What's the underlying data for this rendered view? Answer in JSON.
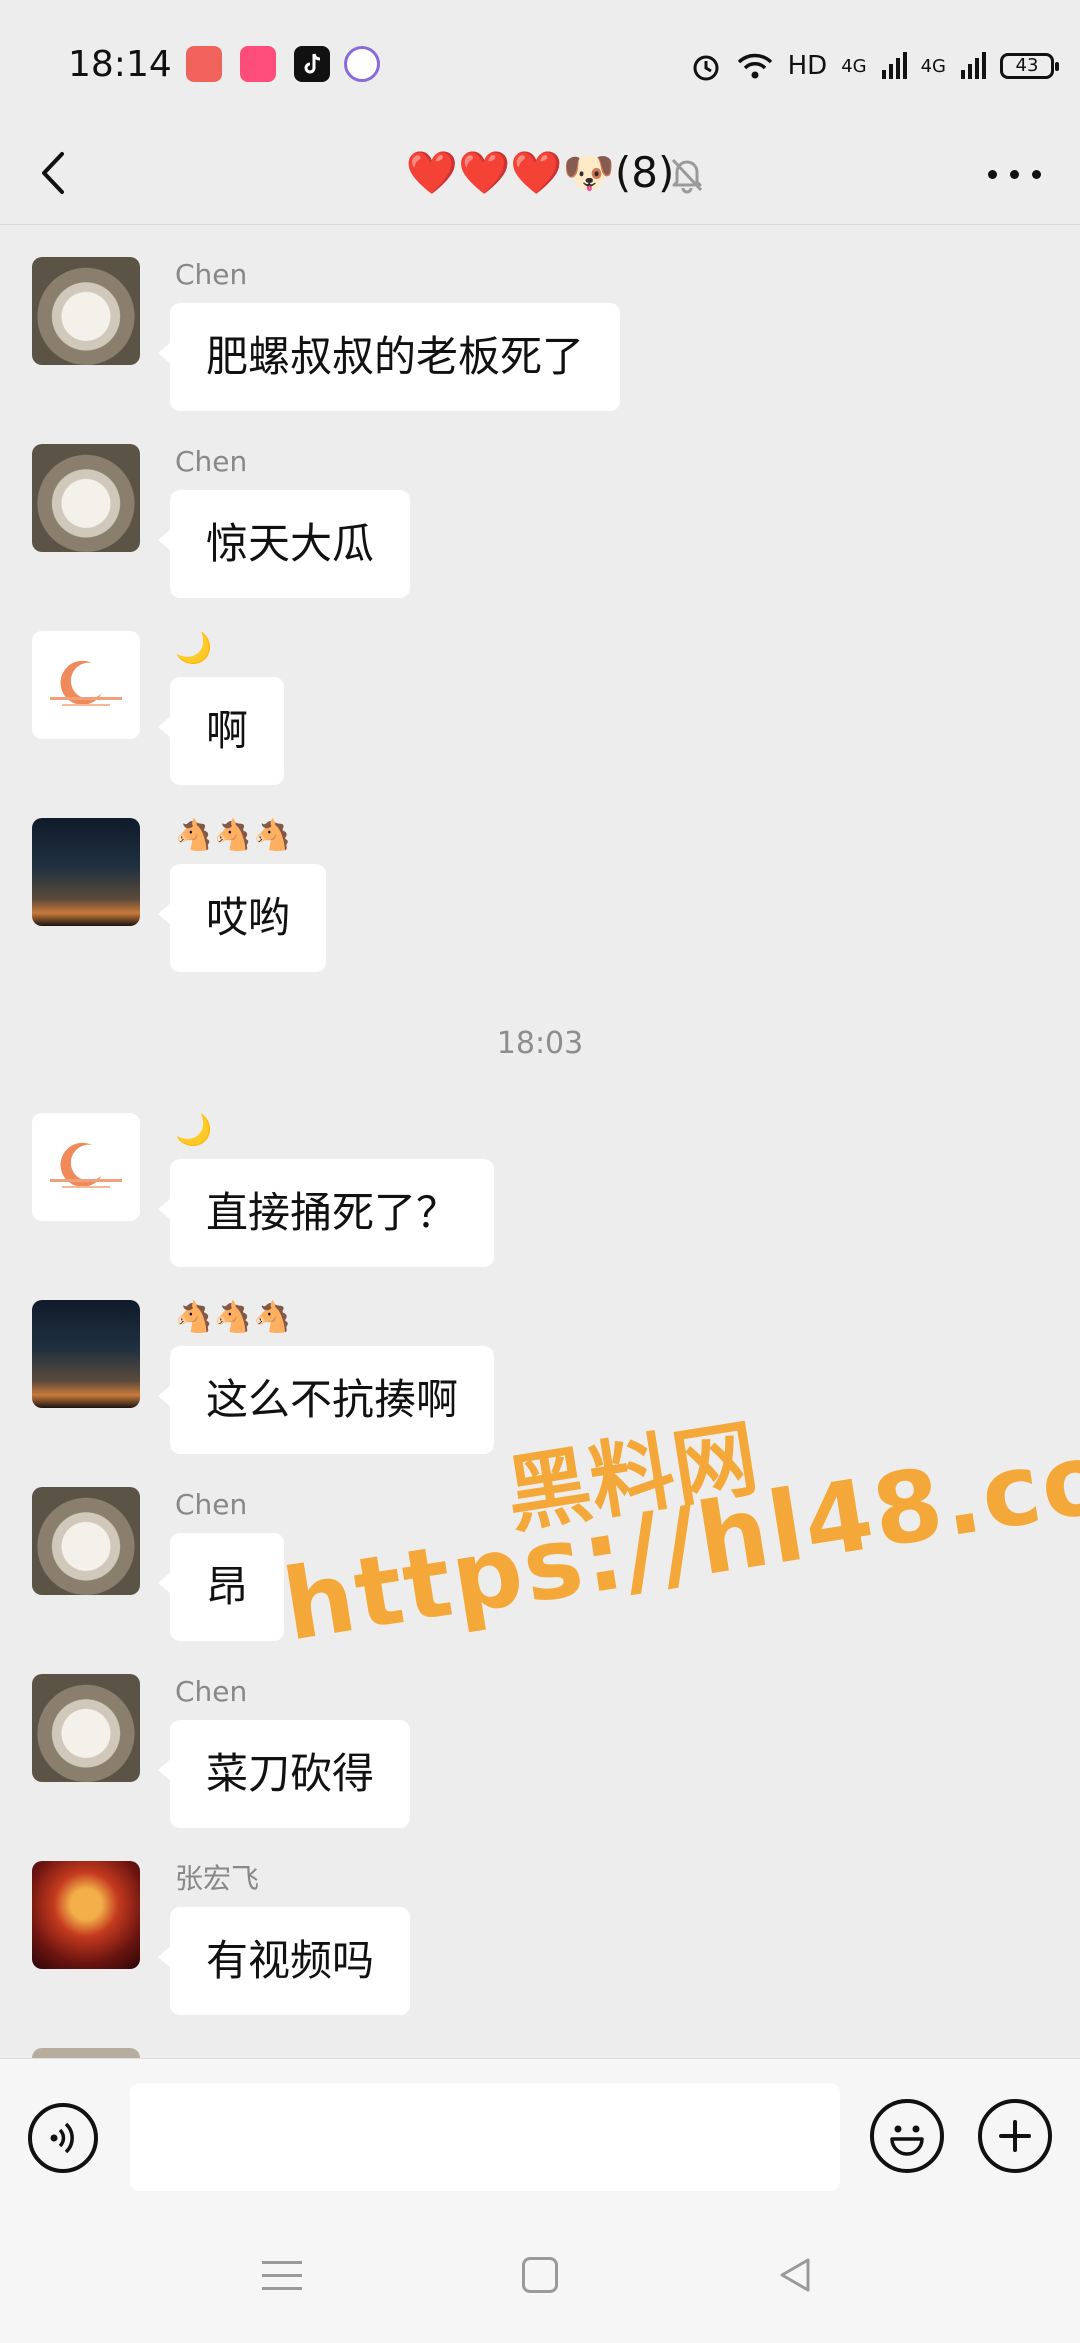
{
  "status_bar": {
    "time": "18:14",
    "network": "HD",
    "signal1": "4G",
    "signal2": "4G",
    "battery": "43"
  },
  "header": {
    "title": "❤️❤️❤️🐶(8)",
    "back_icon": "chevron-left-icon",
    "mute_icon": "bell-off-icon",
    "more_icon": "more-icon"
  },
  "messages": [
    {
      "sender": "Chen",
      "text": "肥螺叔叔的老板死了",
      "avatar": "dog"
    },
    {
      "sender": "Chen",
      "text": "惊天大瓜",
      "avatar": "dog"
    },
    {
      "sender": "🌙",
      "text": "啊",
      "avatar": "moon"
    },
    {
      "sender": "🐴🐴🐴",
      "text": "哎哟",
      "avatar": "night"
    },
    {
      "sender": "🌙",
      "text": "直接捅死了？",
      "avatar": "moon"
    },
    {
      "sender": "🐴🐴🐴",
      "text": "这么不抗揍啊",
      "avatar": "night"
    },
    {
      "sender": "Chen",
      "text": "昂",
      "avatar": "dog"
    },
    {
      "sender": "Chen",
      "text": "菜刀砍得",
      "avatar": "dog"
    },
    {
      "sender": "张宏飞",
      "text": "有视频吗",
      "avatar": "fire"
    }
  ],
  "time_divider": "18:03",
  "watermark": {
    "line1": "黑料网",
    "line2": "https://hl48.co"
  },
  "input_bar": {
    "placeholder": "",
    "voice_icon": "voice-icon",
    "emoji_icon": "emoji-icon",
    "plus_icon": "plus-icon"
  },
  "nav_bar": {
    "menu_icon": "menu-icon",
    "home_icon": "home-icon",
    "back_icon": "back-triangle-icon"
  }
}
